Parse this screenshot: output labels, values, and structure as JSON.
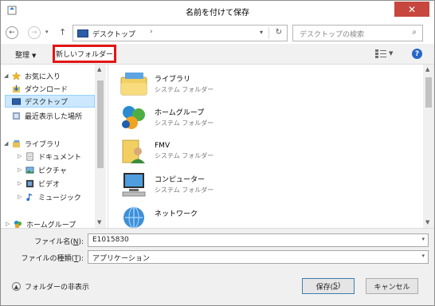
{
  "window": {
    "title": "名前を付けて保存",
    "close_glyph": "✕"
  },
  "address": {
    "back_glyph": "←",
    "forward_glyph": "→",
    "recent_glyph": "▾",
    "up_glyph": "↑",
    "location": "デスクトップ",
    "chevron": "›",
    "dropdown_glyph": "▾",
    "refresh_glyph": "↻"
  },
  "search": {
    "placeholder": "デスクトップの検索",
    "icon": "⌕"
  },
  "toolbar": {
    "organize": "整理",
    "organize_caret": "▼",
    "new_folder": "新しいフォルダー",
    "view_caret": "▼",
    "help": "?"
  },
  "nav": {
    "items": [
      {
        "label": "お気に入り",
        "tri": "◢"
      },
      {
        "label": "ダウンロード"
      },
      {
        "label": "デスクトップ"
      },
      {
        "label": "最近表示した場所"
      },
      {
        "label": "ライブラリ",
        "tri": "◢"
      },
      {
        "label": "ドキュメント",
        "tri": "▷"
      },
      {
        "label": "ピクチャ",
        "tri": "▷"
      },
      {
        "label": "ビデオ",
        "tri": "▷"
      },
      {
        "label": "ミュージック",
        "tri": "▷"
      },
      {
        "label": "ホームグループ",
        "tri": "▷"
      }
    ],
    "scroll_up": "▲",
    "scroll_down": "▼"
  },
  "content": {
    "items": [
      {
        "name": "ライブラリ",
        "sub": "システム フォルダー"
      },
      {
        "name": "ホームグループ",
        "sub": "システム フォルダー"
      },
      {
        "name": "FMV",
        "sub": "システム フォルダー"
      },
      {
        "name": "コンピューター",
        "sub": "システム フォルダー"
      },
      {
        "name": "ネットワーク",
        "sub": ""
      }
    ],
    "scroll_up": "▲",
    "scroll_down": "▼"
  },
  "form": {
    "filename_label": "ファイル名(",
    "filename_key": "N",
    "filename_label_end": "):",
    "filename_value": "E1015830",
    "filetype_label": "ファイルの種類(",
    "filetype_key": "T",
    "filetype_label_end": "):",
    "filetype_value": "アプリケーション",
    "dropdown_glyph": "▾",
    "hide_folders": "フォルダーの非表示",
    "hide_glyph": "▲",
    "save_label": "保存(",
    "save_key": "S",
    "save_label_end": ")",
    "cancel_label": "キャンセル"
  },
  "colors": {
    "highlight_border": "#e21515",
    "selection_bg": "#cce8ff",
    "close_bg": "#c7463d"
  }
}
